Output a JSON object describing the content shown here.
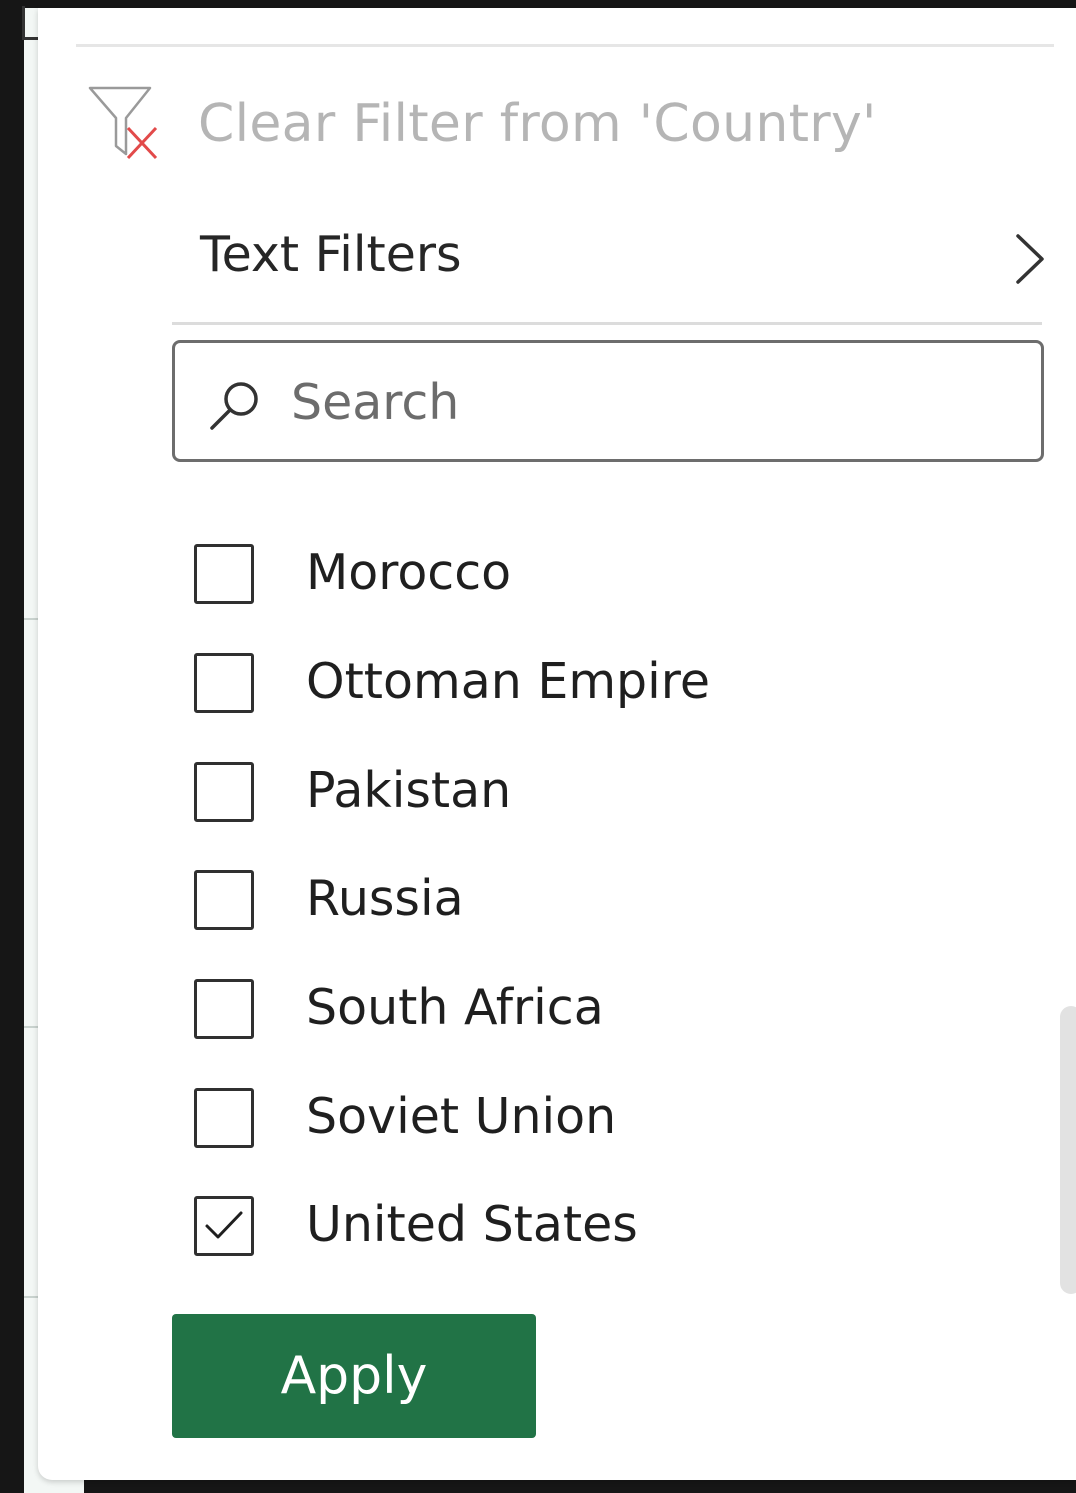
{
  "filter_menu": {
    "clear_filter": {
      "label": "Clear Filter from 'Country'",
      "icon": "clear-filter-icon"
    },
    "text_filters": {
      "label": "Text Filters",
      "icon": "chevron-right-icon"
    },
    "search": {
      "placeholder": "Search",
      "value": "",
      "icon": "search-icon"
    },
    "items": [
      {
        "label": "Morocco",
        "checked": false
      },
      {
        "label": "Ottoman Empire",
        "checked": false
      },
      {
        "label": "Pakistan",
        "checked": false
      },
      {
        "label": "Russia",
        "checked": false
      },
      {
        "label": "South Africa",
        "checked": false
      },
      {
        "label": "Soviet Union",
        "checked": false
      },
      {
        "label": "United States",
        "checked": true
      }
    ],
    "apply_label": "Apply"
  },
  "colors": {
    "accent": "#217346",
    "clear_icon_x": "#e24a4a",
    "disabled_text": "#b5b5b5"
  }
}
